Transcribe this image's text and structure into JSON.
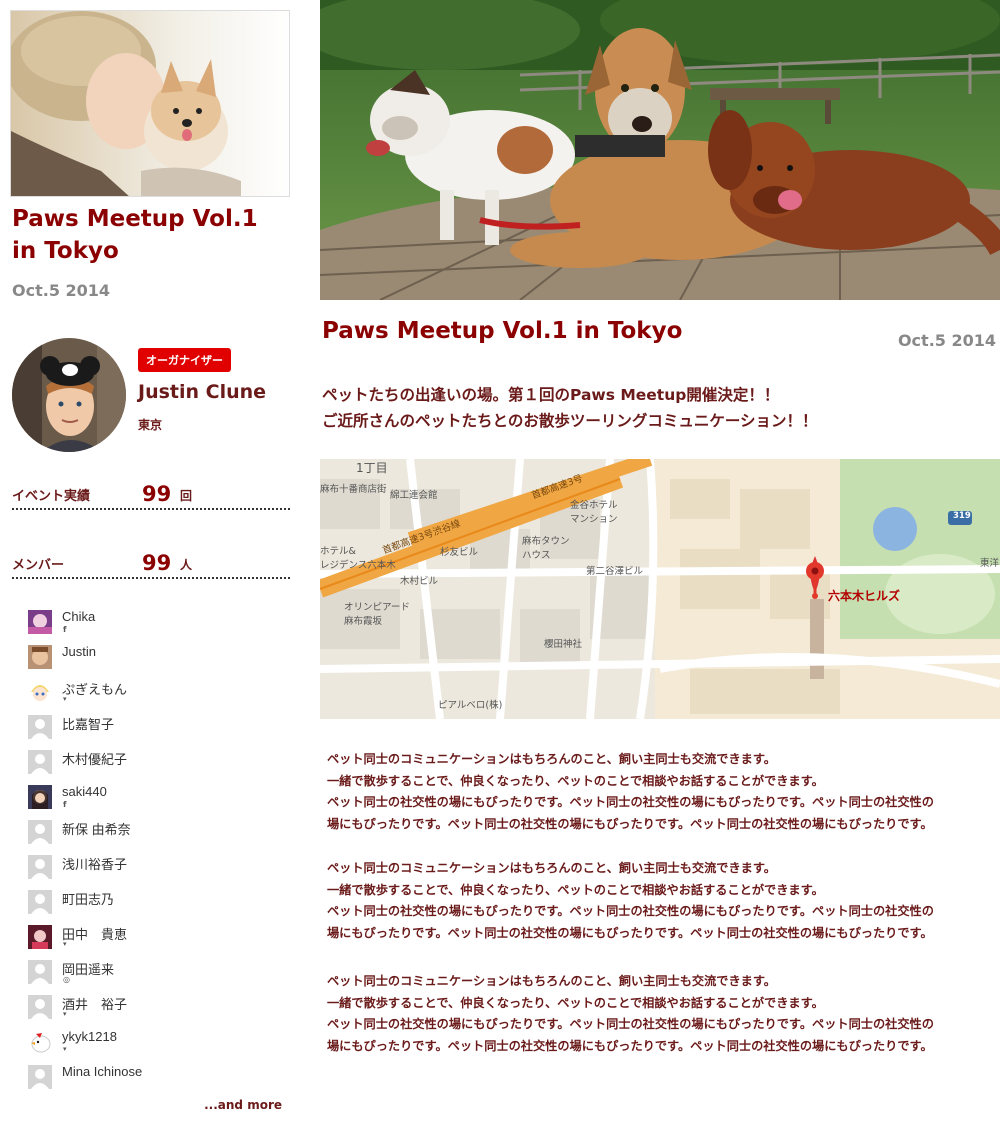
{
  "event": {
    "title": "Paws Meetup Vol.1 in Tokyo",
    "side_title_line1": "Paws Meetup Vol.1",
    "side_title_line2": "in Tokyo",
    "date": "Oct.5 2014"
  },
  "organizer": {
    "badge": "オーガナイザー",
    "name": "Justin Clune",
    "location": "東京"
  },
  "stats": [
    {
      "label": "イベント実績",
      "value": "99",
      "unit": "回"
    },
    {
      "label": "メンバー",
      "value": "99",
      "unit": "人"
    }
  ],
  "members": [
    {
      "name": "Chika",
      "social": "f",
      "avatar": "photo-purple"
    },
    {
      "name": "Justin",
      "social": "",
      "avatar": "photo-face"
    },
    {
      "name": "ぷぎえもん",
      "social": "twitter",
      "avatar": "anime"
    },
    {
      "name": "比嘉智子",
      "social": "",
      "avatar": "default"
    },
    {
      "name": "木村優紀子",
      "social": "",
      "avatar": "default"
    },
    {
      "name": "saki440",
      "social": "f",
      "avatar": "photo-girl"
    },
    {
      "name": "新保 由希奈",
      "social": "",
      "avatar": "default"
    },
    {
      "name": "浅川裕香子",
      "social": "",
      "avatar": "default"
    },
    {
      "name": "町田志乃",
      "social": "",
      "avatar": "default"
    },
    {
      "name": "田中　貴恵",
      "social": "twitter",
      "avatar": "photo-red"
    },
    {
      "name": "岡田遥来",
      "social": "github",
      "avatar": "default"
    },
    {
      "name": "酒井　裕子",
      "social": "twitter",
      "avatar": "default"
    },
    {
      "name": "ykyk1218",
      "social": "twitter",
      "avatar": "bird"
    },
    {
      "name": "Mina Ichinose",
      "social": "",
      "avatar": "default"
    }
  ],
  "and_more": "...and more",
  "tagline": {
    "line1": "ペットたちの出逢いの場。第１回のPaws Meetup開催決定！！",
    "line2": "ご近所さんのペットたちとのお散歩ツーリングコミュニケーション！！"
  },
  "map": {
    "pin_label": "六本木ヒルズ",
    "labels": [
      "1丁目",
      "麻布十番商店街",
      "綿工連会館",
      "金谷ホテル\nマンション",
      "首都高速3号渋谷線",
      "首都高速3号",
      "ホテル&\nレジデンス六本木",
      "杉友ビル",
      "麻布タウン\nハウス",
      "第二谷澤ビル",
      "木村ビル",
      "オリンピアード\n麻布霞坂",
      "櫻田神社",
      "ピアルベロ(株)",
      "319",
      "東洋"
    ]
  },
  "paragraphs": [
    [
      "ペット同士のコミュニケーションはもちろんのこと、飼い主同士も交流できます。",
      "一緒で散歩することで、仲良くなったり、ペットのことで相談やお話することができます。",
      "ペット同士の社交性の場にもぴったりです。ペット同士の社交性の場にもぴったりです。ペット同士の社交性の",
      "場にもぴったりです。ペット同士の社交性の場にもぴったりです。ペット同士の社交性の場にもぴったりです。"
    ],
    [
      "ペット同士のコミュニケーションはもちろんのこと、飼い主同士も交流できます。",
      "一緒で散歩することで、仲良くなったり、ペットのことで相談やお話することができます。",
      "ペット同士の社交性の場にもぴったりです。ペット同士の社交性の場にもぴったりです。ペット同士の社交性の",
      "場にもぴったりです。ペット同士の社交性の場にもぴったりです。ペット同士の社交性の場にもぴったりです。"
    ],
    [
      "ペット同士のコミュニケーションはもちろんのこと、飼い主同士も交流できます。",
      "一緒で散歩することで、仲良くなったり、ペットのことで相談やお話することができます。",
      "ペット同士の社交性の場にもぴったりです。ペット同士の社交性の場にもぴったりです。ペット同士の社交性の",
      "場にもぴったりです。ペット同士の社交性の場にもぴったりです。ペット同士の社交性の場にもぴったりです。"
    ]
  ]
}
